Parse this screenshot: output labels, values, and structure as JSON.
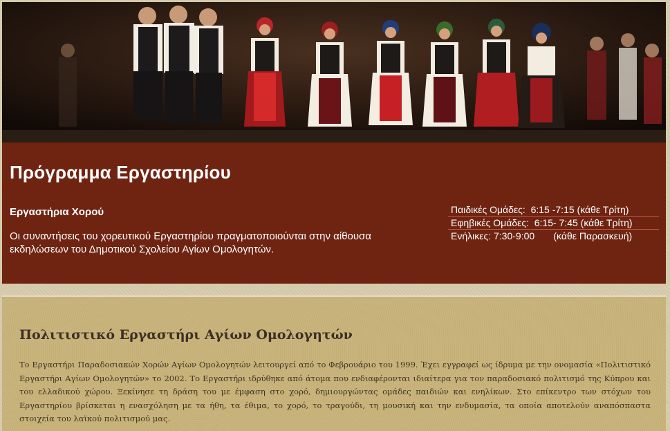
{
  "program": {
    "title": "Πρόγραμμα Εργαστηρίου",
    "subtitle": "Εργαστήρια Χορού",
    "description": "Οι συναντήσεις του χορευτικού Εργαστηρίου πραγματοποιούνται στην αίθουσα εκδηλώσεων του Δημοτικού Σχολείου Αγίων Ομολογητών.",
    "schedule": [
      "Παιδικές Ομάδες:  6:15 -7:15 (κάθε Τρίτη)",
      "Εφηβικές Ομάδες:  6:15- 7:45 (κάθε Τρίτη)",
      "Ενήλικες: 7:30-9:00       (κάθε Παρασκευή)"
    ]
  },
  "culture": {
    "title": "Πολιτιστικό Εργαστήρι Αγίων Ομολογητών",
    "text": " Το Εργαστήρι Παραδοσιακών Χορών Αγίων Ομολογητών λειτουργεί από το Φεβρουάριο του 1999. Έχει εγγραφεί ως ίδρυμα με την ονομασία «Πολιτιστικό Εργαστήρι Αγίων Ομολογητών» το 2002. Το Εργαστήρι ιδρύθηκε από άτομα που ενδιαφέρονται ιδιαίτερα για τον παραδοσιακό πολιτισμό της Κύπρου και του ελλαδικού χώρου. Ξεκίνησε τη δράση του με έμφαση στο χορό, δημιουργώντας ομάδες παιδιών και ενηλίκων. Στο επίκεντρο των στόχων του Εργαστηρίου βρίσκεται η ενασχόληση με τα ήθη, τα έθιμα, το χορό, το τραγούδι, τη μουσική και την ενδυμασία, τα οποία αποτελούν αναπόσπαστα στοιχεία του λαϊκού πολιτισμού μας."
  },
  "colors": {
    "panel_red": "#6f2412",
    "culture_bg": "#c7b27a"
  }
}
